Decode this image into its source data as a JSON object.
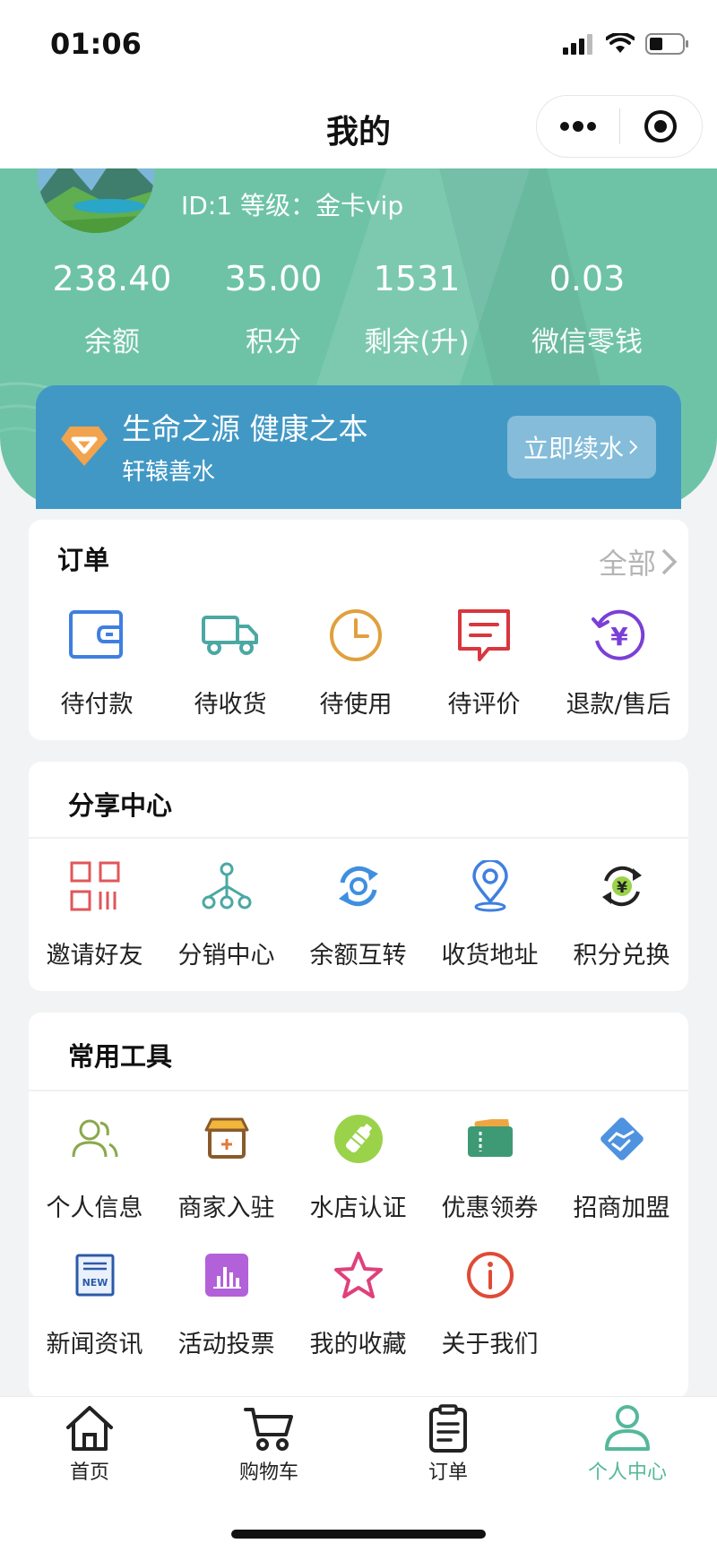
{
  "status": {
    "time": "01:06"
  },
  "nav": {
    "title": "我的"
  },
  "profile": {
    "meta": "ID:1 等级：金卡vip",
    "stats": [
      {
        "value": "238.40",
        "label": "余额"
      },
      {
        "value": "35.00",
        "label": "积分"
      },
      {
        "value": "1531",
        "label": "剩余(升)"
      },
      {
        "value": "0.03",
        "label": "微信零钱"
      }
    ]
  },
  "promo": {
    "title": "生命之源 健康之本",
    "subtitle": "轩辕善水",
    "button": "立即续水"
  },
  "orders": {
    "title": "订单",
    "more": "全部",
    "items": [
      {
        "label": "待付款",
        "icon": "wallet-icon"
      },
      {
        "label": "待收货",
        "icon": "truck-icon"
      },
      {
        "label": "待使用",
        "icon": "clock-icon"
      },
      {
        "label": "待评价",
        "icon": "comment-icon"
      },
      {
        "label": "退款/售后",
        "icon": "refund-icon"
      }
    ]
  },
  "share": {
    "title": "分享中心",
    "items": [
      {
        "label": "邀请好友",
        "icon": "qrcode-icon"
      },
      {
        "label": "分销中心",
        "icon": "network-icon"
      },
      {
        "label": "余额互转",
        "icon": "transfer-icon"
      },
      {
        "label": "收货地址",
        "icon": "location-icon"
      },
      {
        "label": "积分兑换",
        "icon": "exchange-icon"
      }
    ]
  },
  "tools": {
    "title": "常用工具",
    "items": [
      {
        "label": "个人信息",
        "icon": "users-icon"
      },
      {
        "label": "商家入驻",
        "icon": "shop-icon"
      },
      {
        "label": "水店认证",
        "icon": "bottle-icon"
      },
      {
        "label": "优惠领券",
        "icon": "coupon-icon"
      },
      {
        "label": "招商加盟",
        "icon": "handshake-icon"
      },
      {
        "label": "新闻资讯",
        "icon": "news-icon"
      },
      {
        "label": "活动投票",
        "icon": "vote-icon"
      },
      {
        "label": "我的收藏",
        "icon": "star-icon"
      },
      {
        "label": "关于我们",
        "icon": "info-icon"
      }
    ]
  },
  "tabbar": {
    "items": [
      {
        "label": "首页",
        "icon": "home-icon"
      },
      {
        "label": "购物车",
        "icon": "cart-icon"
      },
      {
        "label": "订单",
        "icon": "order-icon"
      },
      {
        "label": "个人中心",
        "icon": "person-icon",
        "active": true
      }
    ]
  },
  "colors": {
    "header": "#6ec3a7",
    "promo": "#4298c5",
    "active_tab": "#55b89b"
  }
}
